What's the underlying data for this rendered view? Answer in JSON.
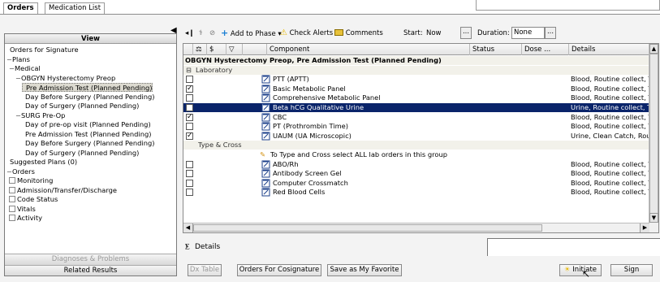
{
  "tabs": [
    {
      "label": "Orders",
      "active": true
    },
    {
      "label": "Medication List",
      "active": false
    }
  ],
  "left_panel": {
    "header": "View",
    "tree": [
      {
        "label": "Orders for Signature",
        "indent": 0,
        "kind": "leaf"
      },
      {
        "label": "Plans",
        "indent": 0,
        "kind": "collapse"
      },
      {
        "label": "Medical",
        "indent": 1,
        "kind": "collapse"
      },
      {
        "label": "OBGYN Hysterectomy Preop",
        "indent": 2,
        "kind": "collapse"
      },
      {
        "label": "Pre Admission Test (Planned Pending)",
        "indent": 3,
        "kind": "leaf",
        "selected": true
      },
      {
        "label": "Day Before Surgery (Planned Pending)",
        "indent": 3,
        "kind": "leaf"
      },
      {
        "label": "Day of Surgery (Planned Pending)",
        "indent": 3,
        "kind": "leaf"
      },
      {
        "label": "SURG Pre-Op",
        "indent": 2,
        "kind": "collapse"
      },
      {
        "label": "Day of pre-op visit (Planned Pending)",
        "indent": 3,
        "kind": "leaf"
      },
      {
        "label": "Pre Admission Test (Planned Pending)",
        "indent": 3,
        "kind": "leaf"
      },
      {
        "label": "Day Before Surgery (Planned Pending)",
        "indent": 3,
        "kind": "leaf"
      },
      {
        "label": "Day of Surgery (Planned Pending)",
        "indent": 3,
        "kind": "leaf"
      },
      {
        "label": "Suggested Plans (0)",
        "indent": 0,
        "kind": "leaf"
      },
      {
        "label": "Orders",
        "indent": 0,
        "kind": "collapse"
      },
      {
        "label": "Monitoring",
        "indent": 1,
        "kind": "check"
      },
      {
        "label": "Admission/Transfer/Discharge",
        "indent": 1,
        "kind": "check"
      },
      {
        "label": "Code Status",
        "indent": 1,
        "kind": "check"
      },
      {
        "label": "Vitals",
        "indent": 1,
        "kind": "check"
      },
      {
        "label": "Activity",
        "indent": 1,
        "kind": "check"
      }
    ],
    "footer_buttons": [
      {
        "label": "Diagnoses & Problems",
        "enabled": false
      },
      {
        "label": "Related Results",
        "enabled": true
      }
    ]
  },
  "toolbar": {
    "add_to_phase": "Add to Phase",
    "check_alerts": "Check Alerts",
    "comments": "Comments",
    "start_label": "Start:",
    "start_value": "Now",
    "duration_label": "Duration:",
    "duration_value": "None",
    "dots": "..."
  },
  "grid": {
    "columns": [
      "$",
      "Component",
      "Status",
      "Dose ...",
      "Details"
    ],
    "rows": [
      {
        "type": "phase",
        "component": "OBGYN Hysterectomy Preop, Pre Admission Test (Planned Pending)"
      },
      {
        "type": "section",
        "component": "Laboratory",
        "expander": "⊟"
      },
      {
        "type": "order",
        "checked": false,
        "component": "PTT (APTT)",
        "details": "Blood, Routine collect, T;"
      },
      {
        "type": "order",
        "checked": true,
        "component": "Basic Metabolic Panel",
        "details": "Blood, Routine collect, T;"
      },
      {
        "type": "order",
        "checked": false,
        "component": "Comprehensive Metabolic Panel",
        "details": "Blood, Routine collect, T;"
      },
      {
        "type": "order",
        "checked": false,
        "component": "Beta hCG Qualitative Urine",
        "details": "Urine, Routine collect, T;",
        "selected": true
      },
      {
        "type": "order",
        "checked": true,
        "component": "CBC",
        "details": "Blood, Routine collect, T;"
      },
      {
        "type": "order",
        "checked": false,
        "component": "PT (Prothrombin Time)",
        "details": "Blood, Routine collect, T;"
      },
      {
        "type": "order",
        "checked": true,
        "component": "UAUM (UA Microscopic)",
        "details": "Urine, Clean Catch, Rout"
      },
      {
        "type": "section",
        "component": "Type & Cross",
        "expander": ""
      },
      {
        "type": "note",
        "component": "To Type and Cross select ALL lab orders in this group"
      },
      {
        "type": "order",
        "checked": false,
        "component": "ABO/Rh",
        "details": "Blood, Routine collect, T;"
      },
      {
        "type": "order",
        "checked": false,
        "component": "Antibody Screen Gel",
        "details": "Blood, Routine collect, T;"
      },
      {
        "type": "order",
        "checked": false,
        "component": "Computer Crossmatch",
        "details": "Blood, Routine collect, T;"
      },
      {
        "type": "order",
        "checked": false,
        "component": "Red Blood Cells",
        "details": "Blood, Routine collect, T;"
      }
    ]
  },
  "details_label": "Details",
  "bottom_buttons": {
    "dx_table": "Dx Table",
    "orders_for_cosignature": "Orders For Cosignature",
    "save_as_favorite": "Save as My Favorite",
    "initiate": "Initiate",
    "sign": "Sign"
  },
  "colors": {
    "selection": "#0a246a",
    "tree_selection": "#dcdad0",
    "check_alerts_icon": "#e8b800",
    "add_icon": "#1a7fd4"
  }
}
